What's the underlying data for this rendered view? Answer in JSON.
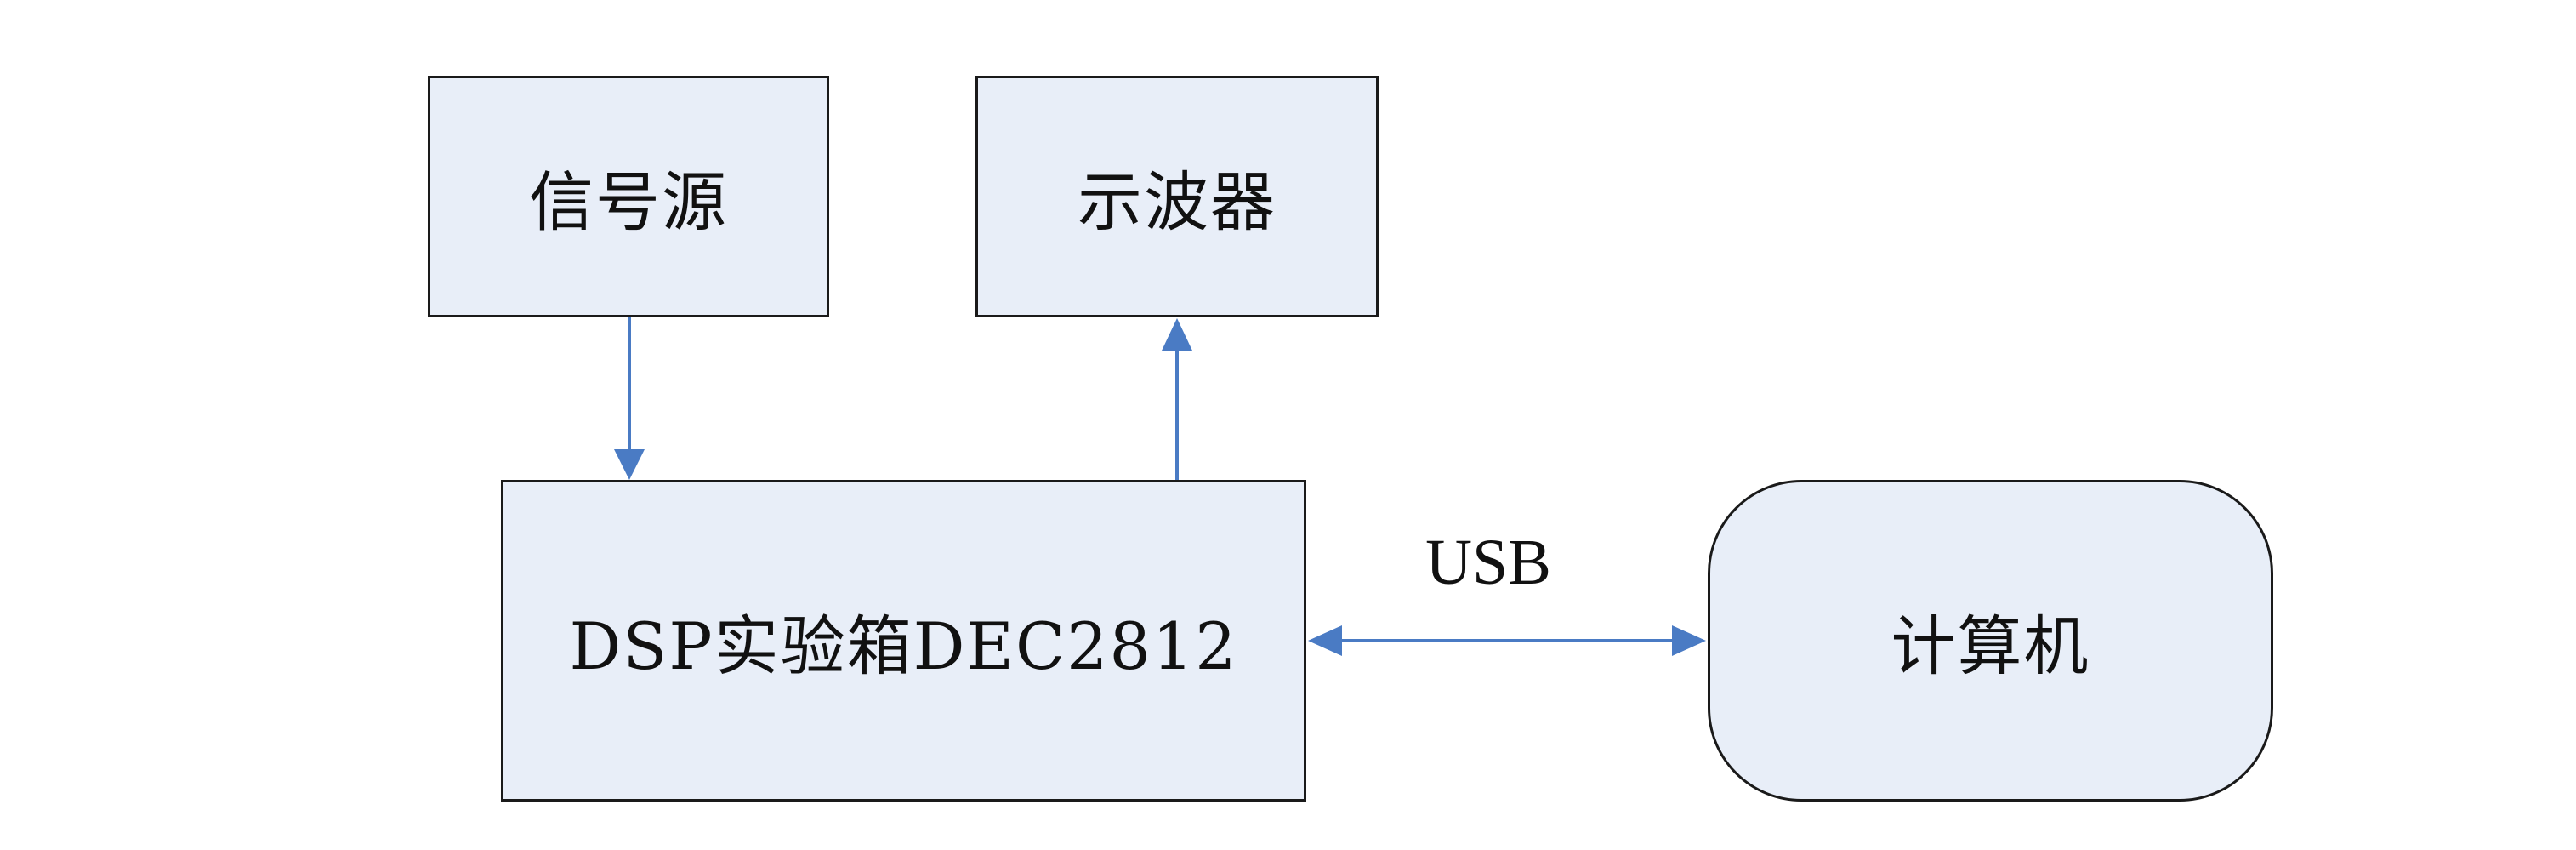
{
  "diagram": {
    "nodes": {
      "signal_source": "信号源",
      "oscilloscope": "示波器",
      "dsp_box": "DSP实验箱DEC2812",
      "computer": "计算机"
    },
    "edges": [
      {
        "from": "signal_source",
        "to": "dsp_box",
        "direction": "one-way",
        "label": ""
      },
      {
        "from": "dsp_box",
        "to": "oscilloscope",
        "direction": "one-way",
        "label": ""
      },
      {
        "from": "dsp_box",
        "to": "computer",
        "direction": "two-way",
        "label": "USB"
      }
    ],
    "usb_label": "USB",
    "colors": {
      "box_fill": "#e8eef8",
      "box_border": "#1a1a1a",
      "arrow": "#4a7bc4",
      "text": "#111111"
    }
  }
}
